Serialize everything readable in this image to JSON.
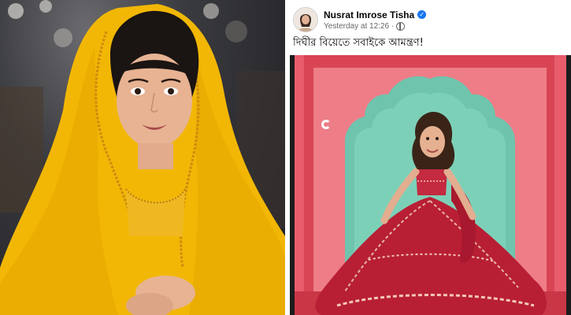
{
  "left_photo": {
    "icon": "portrait-photo"
  },
  "post": {
    "author": {
      "name": "Nusrat Imrose Tisha",
      "verified_icon": "verified-badge-icon",
      "avatar_icon": "profile-avatar"
    },
    "timestamp": "Yesterday at 12:26",
    "separator": "·",
    "audience_icon": "globe-icon",
    "caption": "দিঘীর বিয়েতে সবাইকে আমন্ত্রণ!",
    "image": {
      "icon": "wedding-invitation-photo",
      "watermark_icon": "brand-logo-mark"
    }
  },
  "colors": {
    "facebook_blue": "#1877f2",
    "text_primary": "#050505",
    "text_secondary": "#65676b",
    "dupatta_yellow": "#f2b705",
    "frame_red": "#d8404e",
    "arch_mint": "#6fc4ad"
  }
}
